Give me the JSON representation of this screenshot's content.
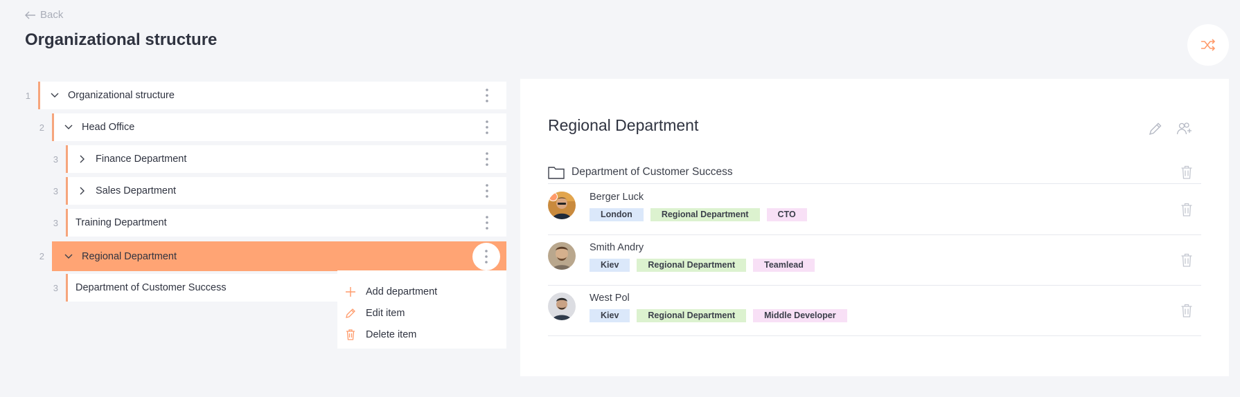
{
  "header": {
    "back_label": "Back",
    "title": "Organizational structure"
  },
  "tree": [
    {
      "level": "1",
      "label": "Organizational structure",
      "expanded": true
    },
    {
      "level": "2",
      "label": "Head Office",
      "expanded": true
    },
    {
      "level": "3",
      "label": "Finance Department",
      "expanded": false
    },
    {
      "level": "3",
      "label": "Sales Department",
      "expanded": false
    },
    {
      "level": "3",
      "label": "Training Department"
    },
    {
      "level": "2",
      "label": "Regional Department",
      "expanded": true,
      "active": true
    },
    {
      "level": "3",
      "label": "Department of Customer Success"
    }
  ],
  "context_menu": {
    "add": "Add department",
    "edit": "Edit item",
    "delete": "Delete item"
  },
  "detail": {
    "title": "Regional Department",
    "subdepartment": "Department of Customer Success",
    "employees": [
      {
        "name": "Berger Luck",
        "city": "London",
        "department": "Regional Department",
        "position": "CTO",
        "head": true
      },
      {
        "name": "Smith Andry",
        "city": "Kiev",
        "department": "Regional Department",
        "position": "Teamlead"
      },
      {
        "name": "West Pol",
        "city": "Kiev",
        "department": "Regional Department",
        "position": "Middle Developer"
      }
    ]
  },
  "colors": {
    "accent": "#ffa474",
    "accent_line": "#f6a57c",
    "tag_city": "#dbe8fa",
    "tag_department": "#dcf2cf",
    "tag_position": "#f8e0f6"
  },
  "icons": [
    "arrow-left-icon",
    "shuffle-icon",
    "chevron-down-icon",
    "chevron-right-icon",
    "kebab-icon",
    "plus-icon",
    "pencil-icon",
    "trash-icon",
    "folder-icon",
    "users-add-icon"
  ]
}
